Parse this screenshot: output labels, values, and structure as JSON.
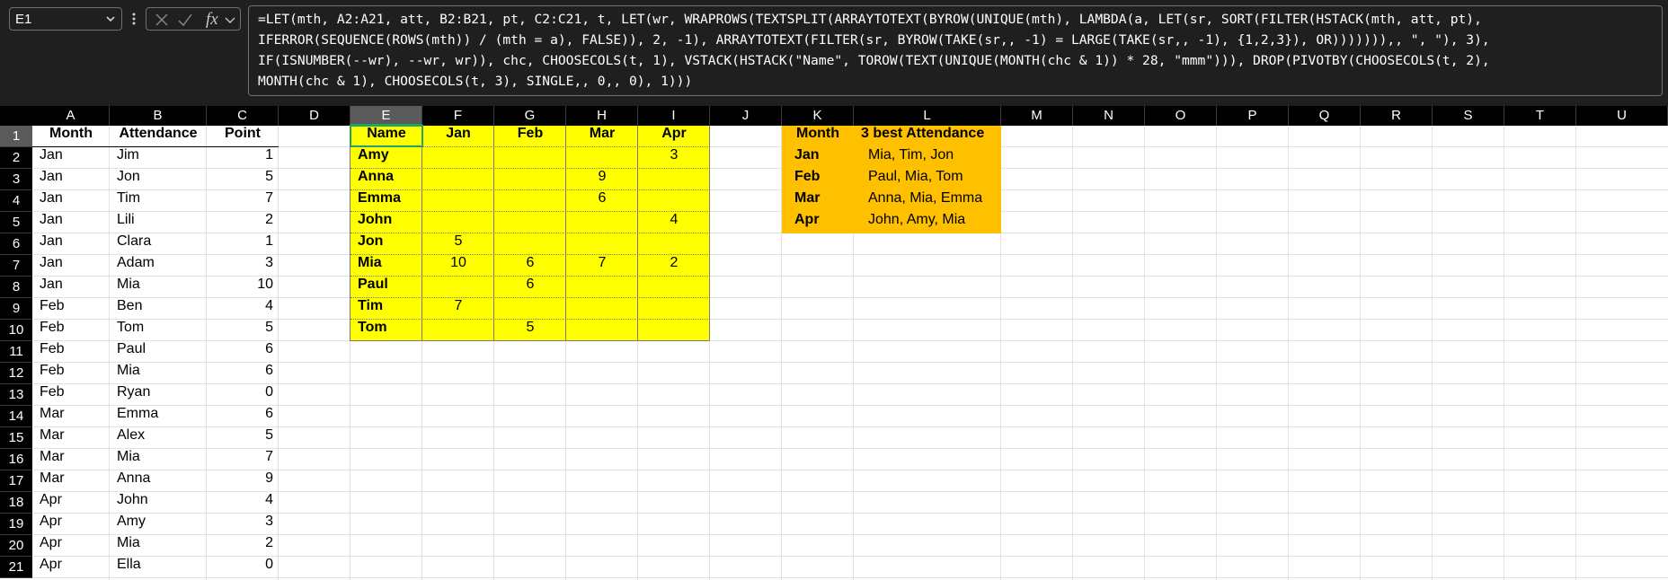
{
  "formula_bar": {
    "name_box": "E1",
    "fx_label": "fx",
    "formula_lines": [
      "=LET(mth, A2:A21, att, B2:B21, pt, C2:C21, t, LET(wr, WRAPROWS(TEXTSPLIT(ARRAYTOTEXT(BYROW(UNIQUE(mth), LAMBDA(a, LET(sr, SORT(FILTER(HSTACK(mth, att, pt),",
      "IFERROR(SEQUENCE(ROWS(mth)) / (mth = a), FALSE)), 2, -1), ARRAYTOTEXT(FILTER(sr, BYROW(TAKE(sr,, -1) = LARGE(TAKE(sr,, -1), {1,2,3}), OR))))))),, \", \"), 3),",
      "IF(ISNUMBER(--wr), --wr, wr)), chc, CHOOSECOLS(t, 1), VSTACK(HSTACK(\"Name\", TOROW(TEXT(UNIQUE(MONTH(chc & 1)) * 28, \"mmm\"))), DROP(PIVOTBY(CHOOSECOLS(t, 2),",
      "MONTH(chc & 1), CHOOSECOLS(t, 3), SINGLE,, 0,, 0), 1)))"
    ]
  },
  "columns": [
    "A",
    "B",
    "C",
    "D",
    "E",
    "F",
    "G",
    "H",
    "I",
    "J",
    "K",
    "L",
    "M",
    "N",
    "O",
    "P",
    "Q",
    "R",
    "S",
    "T",
    "U"
  ],
  "rows": [
    "1",
    "2",
    "3",
    "4",
    "5",
    "6",
    "7",
    "8",
    "9",
    "10",
    "11",
    "12",
    "13",
    "14",
    "15",
    "16",
    "17",
    "18",
    "19",
    "20",
    "21"
  ],
  "source_table": {
    "headers": [
      "Month",
      "Attendance",
      "Point"
    ],
    "rows": [
      [
        "Jan",
        "Jim",
        "1"
      ],
      [
        "Jan",
        "Jon",
        "5"
      ],
      [
        "Jan",
        "Tim",
        "7"
      ],
      [
        "Jan",
        "Lili",
        "2"
      ],
      [
        "Jan",
        "Clara",
        "1"
      ],
      [
        "Jan",
        "Adam",
        "3"
      ],
      [
        "Jan",
        "Mia",
        "10"
      ],
      [
        "Feb",
        "Ben",
        "4"
      ],
      [
        "Feb",
        "Tom",
        "5"
      ],
      [
        "Feb",
        "Paul",
        "6"
      ],
      [
        "Feb",
        "Mia",
        "6"
      ],
      [
        "Feb",
        "Ryan",
        "0"
      ],
      [
        "Mar",
        "Emma",
        "6"
      ],
      [
        "Mar",
        "Alex",
        "5"
      ],
      [
        "Mar",
        "Mia",
        "7"
      ],
      [
        "Mar",
        "Anna",
        "9"
      ],
      [
        "Apr",
        "John",
        "4"
      ],
      [
        "Apr",
        "Amy",
        "3"
      ],
      [
        "Apr",
        "Mia",
        "2"
      ],
      [
        "Apr",
        "Ella",
        "0"
      ]
    ]
  },
  "pivot_table": {
    "headers": [
      "Name",
      "Jan",
      "Feb",
      "Mar",
      "Apr"
    ],
    "rows": [
      [
        "Amy",
        "",
        "",
        "",
        "3"
      ],
      [
        "Anna",
        "",
        "",
        "9",
        ""
      ],
      [
        "Emma",
        "",
        "",
        "6",
        ""
      ],
      [
        "John",
        "",
        "",
        "",
        "4"
      ],
      [
        "Jon",
        "5",
        "",
        "",
        ""
      ],
      [
        "Mia",
        "10",
        "6",
        "7",
        "2"
      ],
      [
        "Paul",
        "",
        "6",
        "",
        ""
      ],
      [
        "Tim",
        "7",
        "",
        "",
        ""
      ],
      [
        "Tom",
        "",
        "5",
        "",
        ""
      ]
    ]
  },
  "best_table": {
    "headers": [
      "Month",
      "3 best Attendance"
    ],
    "rows": [
      [
        "Jan",
        "Mia, Tim, Jon"
      ],
      [
        "Feb",
        "Paul, Mia, Tom"
      ],
      [
        "Mar",
        "Anna, Mia, Emma"
      ],
      [
        "Apr",
        "John, Amy, Mia"
      ]
    ]
  },
  "colors": {
    "pivot_fill": "#ffff00",
    "best_fill": "#ffc000",
    "selection": "#21a366",
    "header_bg": "#000000"
  }
}
